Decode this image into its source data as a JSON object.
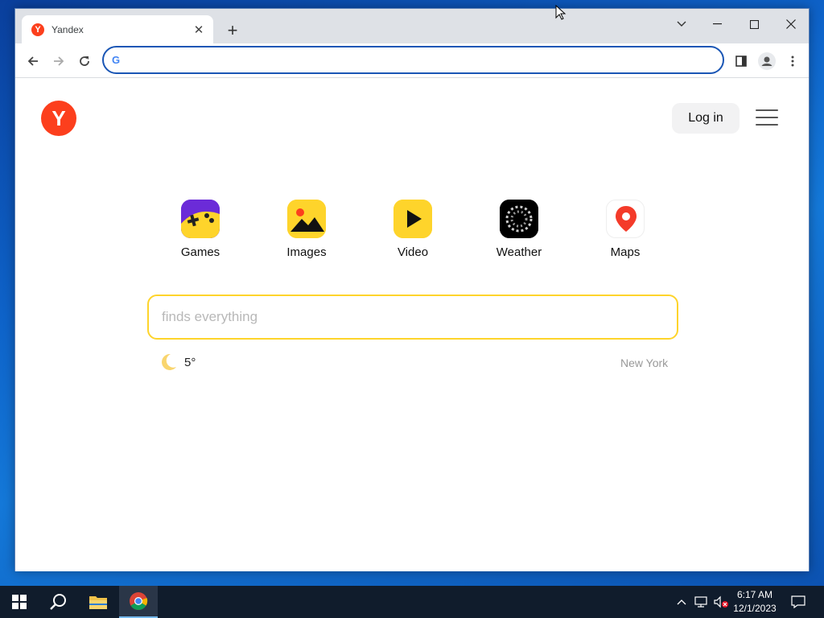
{
  "browser": {
    "tab": {
      "title": "Yandex",
      "favicon_letter": "Y"
    },
    "omnibox": {
      "value": "",
      "placeholder": ""
    }
  },
  "page": {
    "logo_letter": "Y",
    "login_label": "Log in",
    "services": [
      {
        "label": "Games",
        "icon": "games-icon"
      },
      {
        "label": "Images",
        "icon": "images-icon"
      },
      {
        "label": "Video",
        "icon": "video-icon"
      },
      {
        "label": "Weather",
        "icon": "weather-icon"
      },
      {
        "label": "Maps",
        "icon": "maps-icon"
      }
    ],
    "search": {
      "placeholder": "finds everything",
      "value": ""
    },
    "weather": {
      "temperature": "5°",
      "icon": "moon-icon"
    },
    "city": "New York"
  },
  "taskbar": {
    "time": "6:17 AM",
    "date": "12/1/2023"
  },
  "colors": {
    "brand_red": "#fc3f1d",
    "search_border": "#fed42b",
    "omnibox_border": "#1a56b5"
  }
}
